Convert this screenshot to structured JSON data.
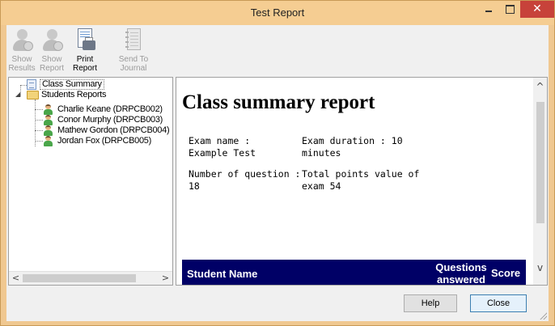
{
  "window": {
    "title": "Test Report",
    "close_glyph": "✕"
  },
  "toolbar": {
    "show_results": {
      "line1": "Show",
      "line2": "Results",
      "enabled": false,
      "icon": "person-icon"
    },
    "show_report": {
      "line1": "Show",
      "line2": "Report",
      "enabled": false,
      "icon": "person-icon"
    },
    "print_report": {
      "line1": "Print",
      "line2": "Report",
      "enabled": true,
      "icon": "print-icon"
    },
    "send_to_journal": {
      "line1": "Send To",
      "line2": "Journal",
      "enabled": false,
      "icon": "journal-icon"
    }
  },
  "tree": {
    "class_summary": "Class Summary",
    "students_reports": "Students Reports",
    "students": [
      "Charlie Keane (DRPCB002)",
      "Conor Murphy (DRPCB003)",
      "Mathew Gordon (DRPCB004)",
      "Jordan Fox (DRPCB005)"
    ],
    "scroll_left": "<",
    "scroll_right": ">"
  },
  "report": {
    "title": "Class summary report",
    "exam_name_label": "Exam name :",
    "exam_name_value": "Example Test",
    "duration_line1": "Exam duration : 10",
    "duration_line2": "minutes",
    "num_questions_line1": "Number of question :",
    "num_questions_line2": "18",
    "points_line1": "Total points value of",
    "points_line2": "exam 54",
    "scroll_up": "^",
    "scroll_down": "v",
    "table_header": {
      "student_name": "Student Name",
      "questions_line1": "Questions",
      "questions_line2": "answered",
      "score": "Score"
    }
  },
  "footer": {
    "help": "Help",
    "close": "Close"
  },
  "colors": {
    "title_bar": "#f5cd92",
    "close_button": "#c7423a",
    "table_header": "#000066"
  }
}
